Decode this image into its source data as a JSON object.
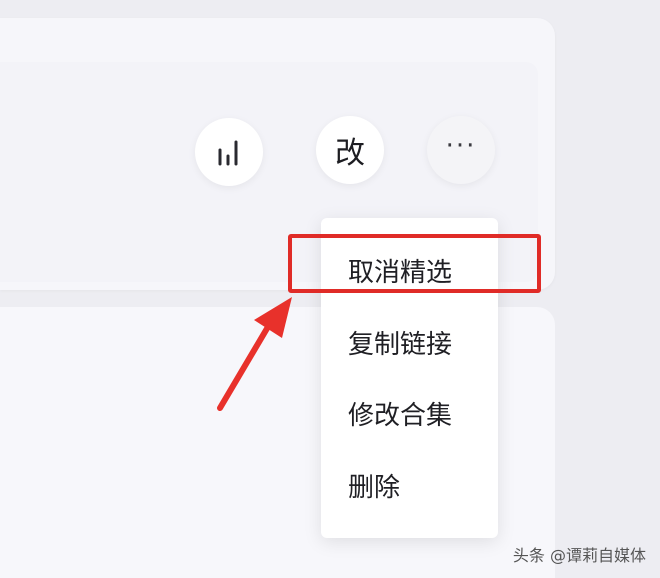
{
  "toolbar": {
    "stats_icon": "bar-chart-icon",
    "edit_label": "改",
    "more_label": "···"
  },
  "menu": {
    "items": [
      {
        "label": "取消精选"
      },
      {
        "label": "复制链接"
      },
      {
        "label": "修改合集"
      },
      {
        "label": "删除"
      }
    ]
  },
  "annotation": {
    "highlight_color": "#e02b27",
    "arrow_color": "#e8312b"
  },
  "watermark": {
    "text": "头条 @谭莉自媒体"
  }
}
